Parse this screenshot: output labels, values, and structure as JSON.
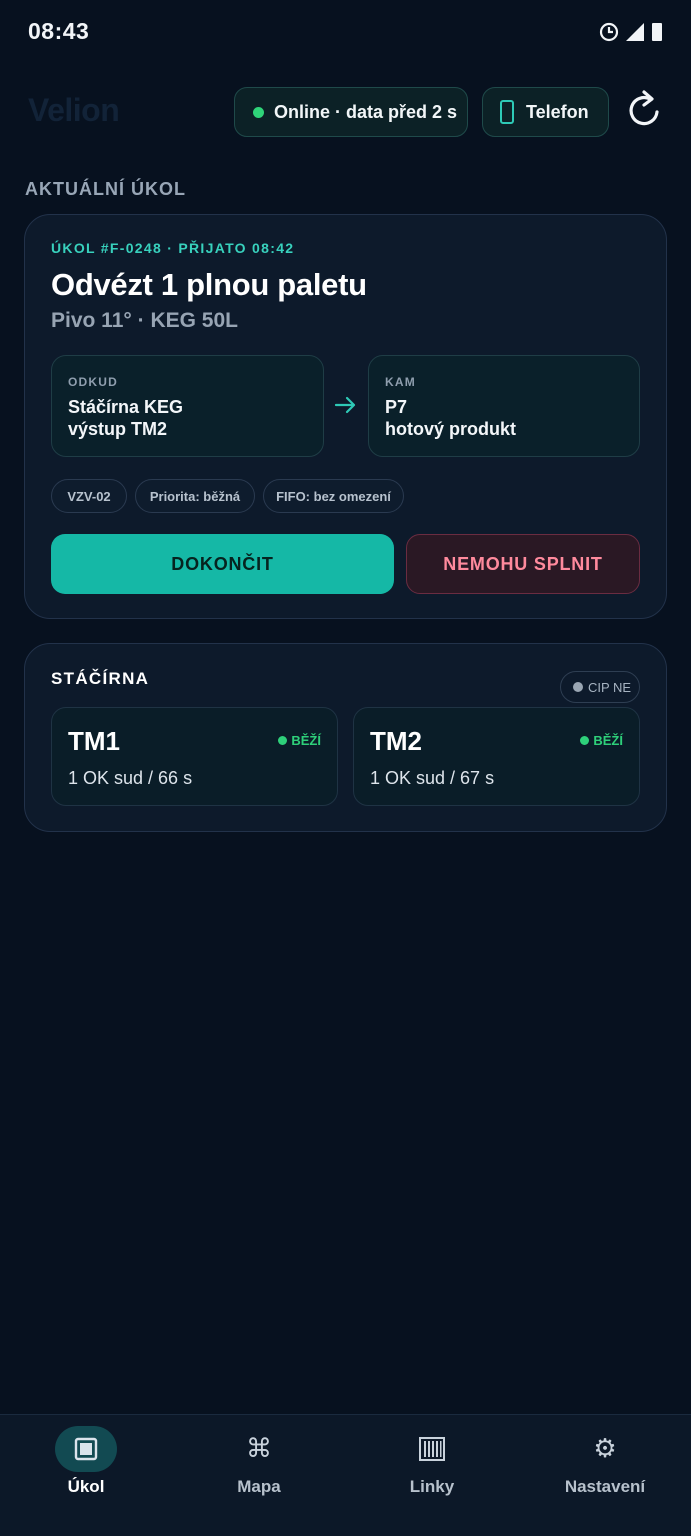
{
  "status_bar": {
    "time": "08:43"
  },
  "header": {
    "brand": "Velion",
    "online_label": "Online · data před 2 s",
    "device_label": "Telefon"
  },
  "section": {
    "title": "AKTUÁLNÍ ÚKOL"
  },
  "task": {
    "meta": "ÚKOL #F-0248 · PŘIJATO 08:42",
    "title": "Odvézt 1 plnou paletu",
    "subtitle": "Pivo 11° · KEG 50L",
    "from": {
      "label": "ODKUD",
      "line1": "Stáčírna KEG",
      "line2": "výstup TM2"
    },
    "to": {
      "label": "KAM",
      "line1": "P7",
      "line2": "hotový produkt"
    },
    "chips": [
      "VZV-02",
      "Priorita: běžná",
      "FIFO: bez omezení"
    ],
    "done_label": "DOKONČIT",
    "fail_label": "NEMOHU SPLNIT"
  },
  "filling": {
    "title": "STÁČÍRNA",
    "cip_label": "CIP NE",
    "machines": [
      {
        "name": "TM1",
        "state": "BĚŽÍ",
        "stat": "1 OK sud / 66 s"
      },
      {
        "name": "TM2",
        "state": "BĚŽÍ",
        "stat": "1 OK sud / 67 s"
      }
    ]
  },
  "nav": {
    "items": [
      {
        "label": "Úkol",
        "icon": "task-icon",
        "active": true
      },
      {
        "label": "Mapa",
        "icon": "command-icon",
        "active": false
      },
      {
        "label": "Linky",
        "icon": "barcode-icon",
        "active": false
      },
      {
        "label": "Nastavení",
        "icon": "gear-icon",
        "active": false
      }
    ]
  },
  "colors": {
    "background": "#07111f",
    "accent": "#15b8a6",
    "danger": "#ff8a9d",
    "online": "#2fd479"
  }
}
